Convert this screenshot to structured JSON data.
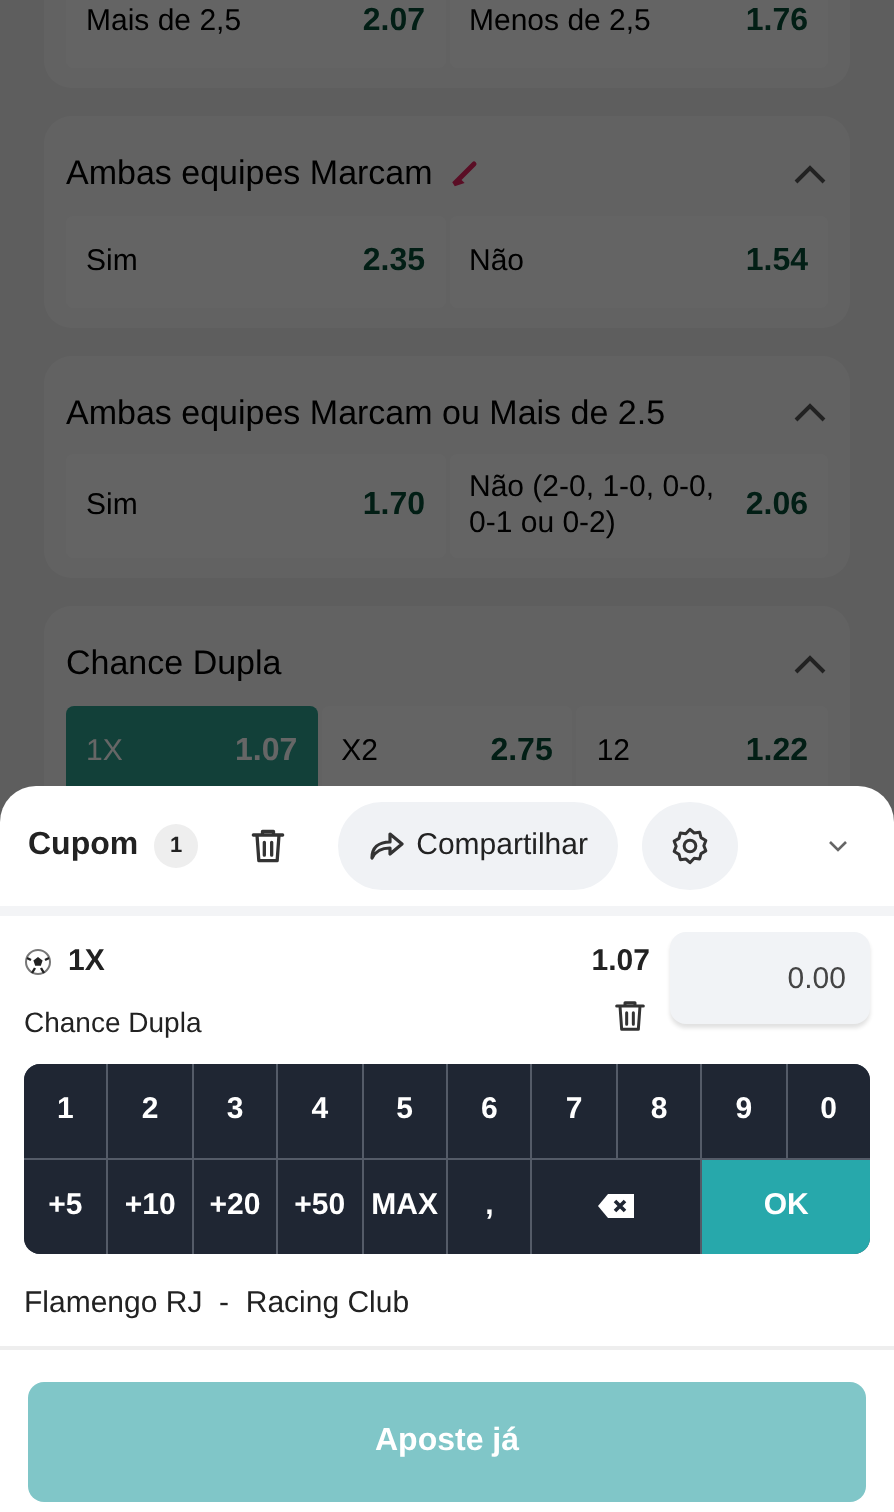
{
  "markets": [
    {
      "outcomes": [
        {
          "label": "Mais de 2,5",
          "odds": "2.07",
          "selected": false
        },
        {
          "label": "Menos de 2,5",
          "odds": "1.76",
          "selected": false
        }
      ]
    },
    {
      "title": "Ambas equipes Marcam",
      "expanded": true,
      "hot": true,
      "outcomes": [
        {
          "label": "Sim",
          "odds": "2.35",
          "selected": false
        },
        {
          "label": "Não",
          "odds": "1.54",
          "selected": false
        }
      ]
    },
    {
      "title": "Ambas equipes Marcam ou Mais de 2.5",
      "expanded": true,
      "hot": false,
      "outcomes": [
        {
          "label": "Sim",
          "odds": "1.70",
          "selected": false
        },
        {
          "label": "Não (2-0, 1-0, 0-0, 0-1 ou 0-2)",
          "odds": "2.06",
          "selected": false
        }
      ]
    },
    {
      "title": "Chance Dupla",
      "expanded": true,
      "hot": false,
      "outcomes": [
        {
          "label": "1X",
          "odds": "1.07",
          "selected": true
        },
        {
          "label": "X2",
          "odds": "2.75",
          "selected": false
        },
        {
          "label": "12",
          "odds": "1.22",
          "selected": false
        }
      ]
    }
  ],
  "coupon": {
    "title": "Cupom",
    "count": "1",
    "share_label": "Compartilhar"
  },
  "selection": {
    "pick": "1X",
    "market": "Chance Dupla",
    "odds": "1.07",
    "stake": "0.00"
  },
  "keypad": [
    {
      "label": "1",
      "kind": "key"
    },
    {
      "label": "2",
      "kind": "key"
    },
    {
      "label": "3",
      "kind": "key"
    },
    {
      "label": "4",
      "kind": "key"
    },
    {
      "label": "5",
      "kind": "key"
    },
    {
      "label": "6",
      "kind": "key"
    },
    {
      "label": "7",
      "kind": "key"
    },
    {
      "label": "8",
      "kind": "key"
    },
    {
      "label": "9",
      "kind": "key"
    },
    {
      "label": "0",
      "kind": "key"
    },
    {
      "label": "+5",
      "kind": "key"
    },
    {
      "label": "+10",
      "kind": "key"
    },
    {
      "label": "+20",
      "kind": "key"
    },
    {
      "label": "+50",
      "kind": "key"
    },
    {
      "label": "MAX",
      "kind": "key"
    },
    {
      "label": ",",
      "kind": "key"
    },
    {
      "kind": "backspace"
    },
    {
      "label": "OK",
      "kind": "confirm"
    }
  ],
  "match": "Flamengo RJ  -  Racing Club",
  "place_bet": {
    "label": "Aposte já",
    "disabled": true
  }
}
